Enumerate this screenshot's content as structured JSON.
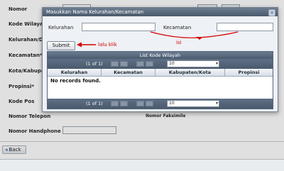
{
  "form": {
    "labels": {
      "nomor": "Nomor",
      "kode_wilayah": "Kode Wilayah",
      "kelurahan_desa": "Kelurahan/De",
      "kecamatan": "Kecamatan*",
      "kota_kabupaten": "Kota/Kabupat",
      "propinsi": "Propinsi*",
      "kode_pos": "Kode Pos",
      "nomor_telepon": "Nomor Telepon",
      "nomor_handphone": "Nomor Handphone",
      "nomor_faksimile": "Nomor Faksimile"
    },
    "nomor_value": "",
    "right_field_1": "",
    "right_field_2": "",
    "back_label": "Back"
  },
  "dialog": {
    "title": "Masukkan Nama Kelurahan/Kecamatan",
    "kelurahan_label": "Kelurahan",
    "kelurahan_value": "",
    "kecamatan_label": "Kecamatan",
    "kecamatan_value": "",
    "submit_label": "Submit",
    "annotation_click": "lalu klik",
    "annotation_fill": "isi"
  },
  "grid": {
    "caption": "List Kode Wilayah",
    "pager_text": "(1 of 1)",
    "rows_per_page": "10",
    "columns": [
      "Kelurahan",
      "Kecamatan",
      "Kabupaten/Kota",
      "Propinsi"
    ],
    "empty_message": "No records found."
  },
  "colors": {
    "annotation": "#d30000",
    "titlebar": "#4a596b",
    "grid_header": "#4b5b6e"
  }
}
